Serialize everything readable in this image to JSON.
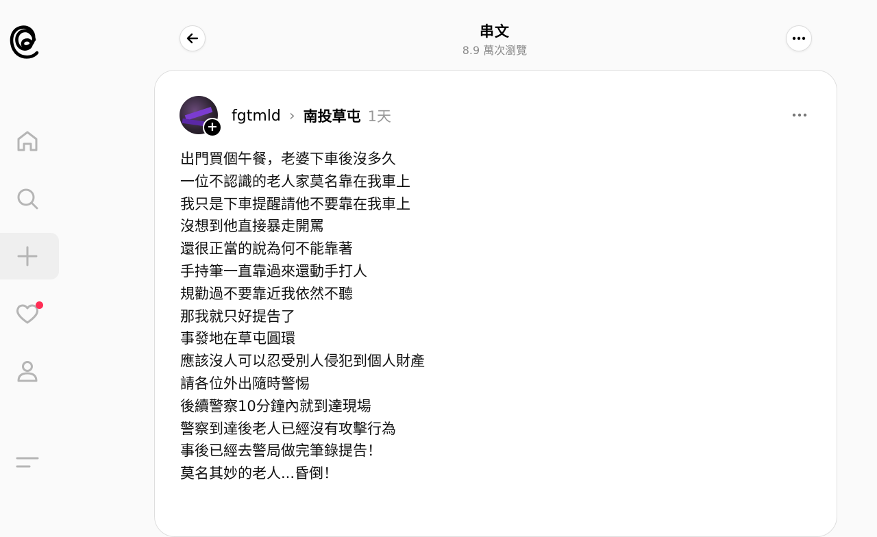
{
  "header": {
    "title": "串文",
    "views": "8.9 萬次瀏覽"
  },
  "sidebar": {
    "items": [
      {
        "icon": "home-icon"
      },
      {
        "icon": "search-icon"
      },
      {
        "icon": "create-icon"
      },
      {
        "icon": "heart-icon",
        "has_notification": true
      },
      {
        "icon": "profile-icon"
      },
      {
        "icon": "menu-icon"
      }
    ]
  },
  "post": {
    "username": "fgtmld",
    "topic": "南投草屯",
    "time": "1天",
    "lines": [
      "出門買個午餐，老婆下車後沒多久",
      "一位不認識的老人家莫名靠在我車上",
      "我只是下車提醒請他不要靠在我車上",
      "沒想到他直接暴走開罵",
      "還很正當的說為何不能靠著",
      "手持筆一直靠過來還動手打人",
      "規勸過不要靠近我依然不聽",
      "那我就只好提告了",
      "事發地在草屯圓環",
      "應該沒人可以忍受別人侵犯到個人財產",
      "請各位外出隨時警惕",
      "後續警察10分鐘內就到達現場",
      "警察到達後老人已經沒有攻擊行為",
      "事後已經去警局做完筆錄提告！",
      "莫名其妙的老人...昏倒！"
    ]
  },
  "colors": {
    "notification": "#ff2d55",
    "muted_text": "#8a8a8a",
    "card_border": "#dedede"
  }
}
